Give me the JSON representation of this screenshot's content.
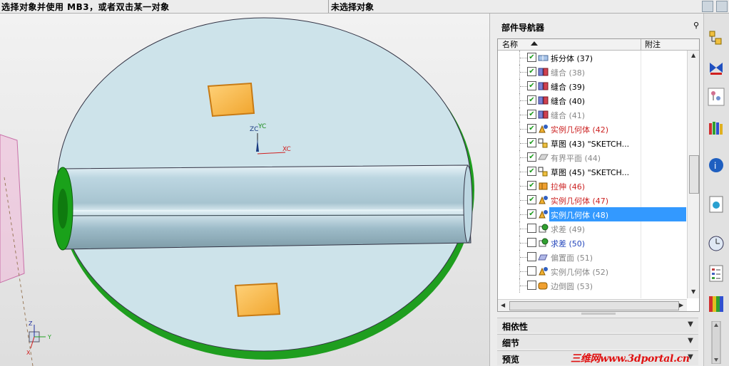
{
  "status_bar": {
    "prompt": "选择对象并使用 MB3，或者双击某一对象",
    "selection": "未选择对象"
  },
  "viewport": {
    "labels": {
      "zc": "ZC",
      "yc": "YC",
      "xc": "XC",
      "z": "Z",
      "y": "Y",
      "x": "X"
    }
  },
  "navigator": {
    "title": "部件导航器",
    "columns": {
      "name": "名称",
      "note": "附注"
    },
    "items": [
      {
        "label": "拆分体 (37)",
        "checked": true,
        "color": "#000000",
        "icon": "split-body-icon"
      },
      {
        "label": "缝合 (38)",
        "checked": true,
        "color": "#888888",
        "icon": "sew-icon"
      },
      {
        "label": "缝合 (39)",
        "checked": true,
        "color": "#000000",
        "icon": "sew-icon"
      },
      {
        "label": "缝合 (40)",
        "checked": true,
        "color": "#000000",
        "icon": "sew-icon"
      },
      {
        "label": "缝合 (41)",
        "checked": true,
        "color": "#888888",
        "icon": "sew-icon"
      },
      {
        "label": "实例几何体 (42)",
        "checked": true,
        "color": "#cc2222",
        "icon": "instance-geometry-icon"
      },
      {
        "label": "草图 (43) \"SKETCH...",
        "checked": true,
        "color": "#000000",
        "icon": "sketch-icon"
      },
      {
        "label": "有界平面 (44)",
        "checked": true,
        "color": "#888888",
        "icon": "bounded-plane-icon"
      },
      {
        "label": "草图 (45) \"SKETCH...",
        "checked": true,
        "color": "#000000",
        "icon": "sketch-icon"
      },
      {
        "label": "拉伸 (46)",
        "checked": true,
        "color": "#cc2222",
        "icon": "extrude-icon"
      },
      {
        "label": "实例几何体 (47)",
        "checked": true,
        "color": "#cc2222",
        "icon": "instance-geometry-icon"
      },
      {
        "label": "实例几何体 (48)",
        "checked": true,
        "color": "#ffffff",
        "icon": "instance-geometry-icon",
        "selected": true
      },
      {
        "label": "求差 (49)",
        "checked": false,
        "color": "#888888",
        "icon": "subtract-icon"
      },
      {
        "label": "求差 (50)",
        "checked": false,
        "color": "#2244bb",
        "icon": "subtract-icon"
      },
      {
        "label": "偏置面 (51)",
        "checked": false,
        "color": "#888888",
        "icon": "offset-face-icon"
      },
      {
        "label": "实例几何体 (52)",
        "checked": false,
        "color": "#888888",
        "icon": "instance-geometry-icon"
      },
      {
        "label": "边倒圆 (53)",
        "checked": false,
        "color": "#888888",
        "icon": "edge-blend-icon"
      }
    ],
    "sections": [
      {
        "label": "相依性"
      },
      {
        "label": "细节"
      },
      {
        "label": "预览"
      }
    ]
  },
  "resource_bar": {
    "icons": [
      "assembly-navigator-icon",
      "constraint-navigator-icon",
      "part-navigator-icon",
      "reuse-library-icon",
      "web-browser-icon",
      "history-icon",
      "system-materials-icon",
      "clock-icon",
      "process-studio-icon",
      "roles-icon"
    ]
  },
  "watermark": "三维网www.3dportal.cn"
}
